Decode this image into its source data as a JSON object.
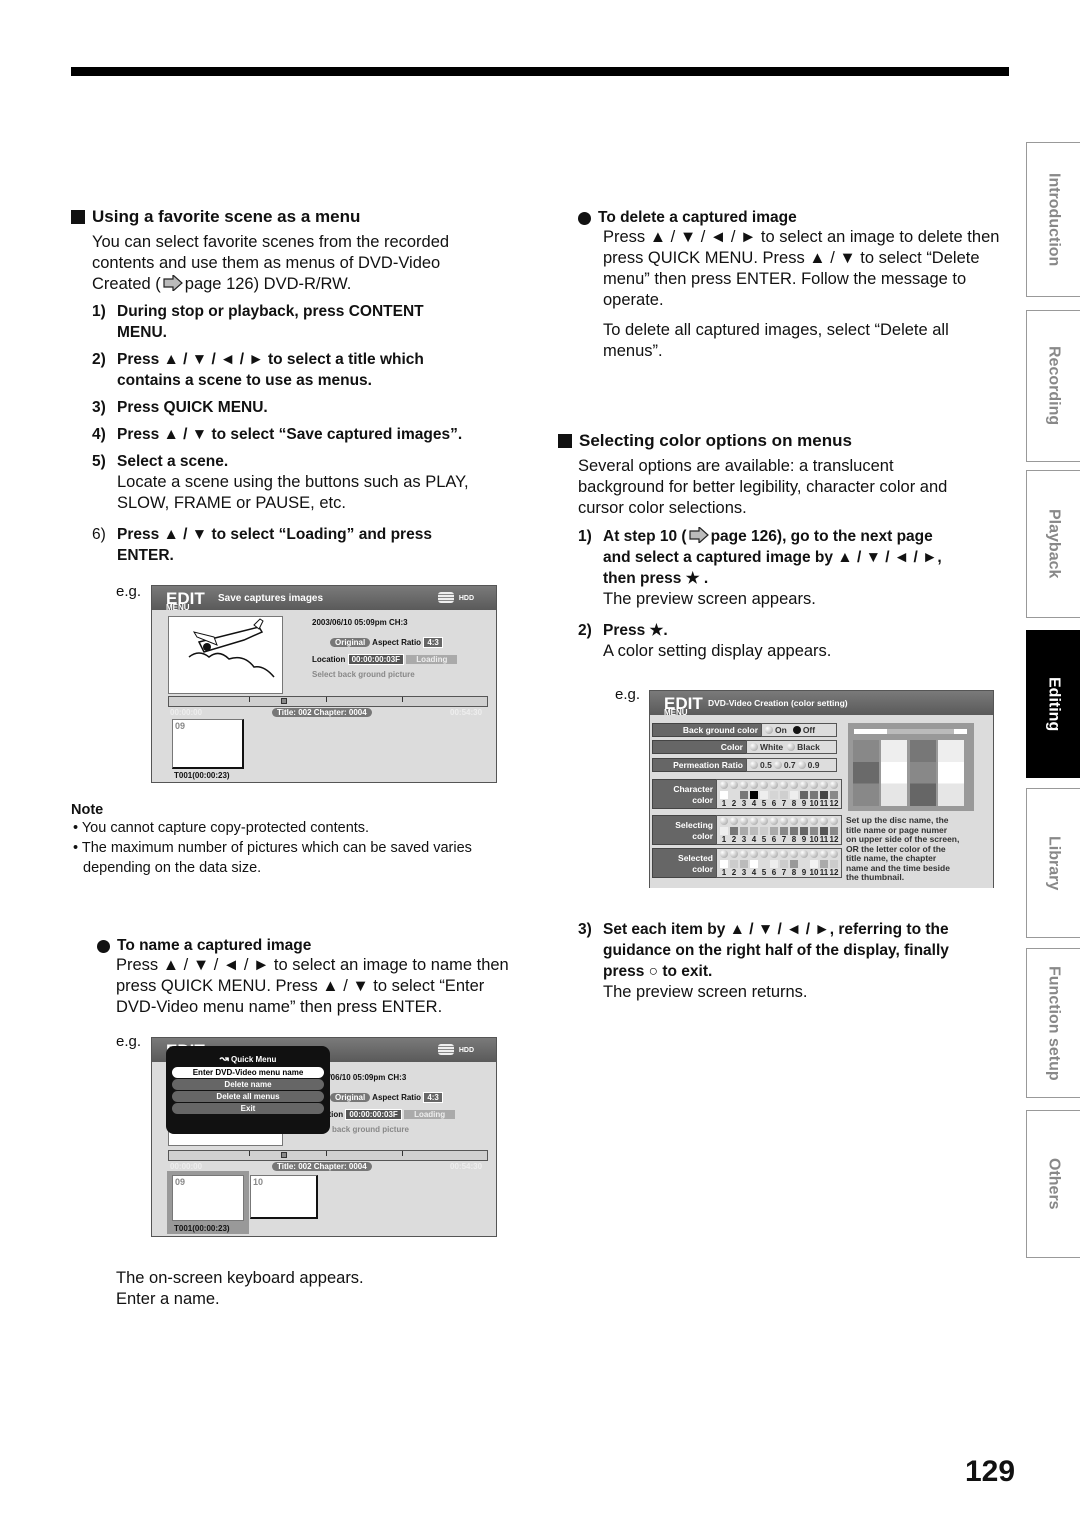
{
  "page_number": "129",
  "side_tabs": [
    {
      "label": "Introduction",
      "active": false
    },
    {
      "label": "Recording",
      "active": false
    },
    {
      "label": "Playback",
      "active": false
    },
    {
      "label": "Editing",
      "active": true
    },
    {
      "label": "Library",
      "active": false
    },
    {
      "label": "Function setup",
      "active": false
    },
    {
      "label": "Others",
      "active": false
    }
  ],
  "left": {
    "section_title": "Using a favorite scene as a menu",
    "intro_1": "You can select favorite scenes from the recorded",
    "intro_2": "contents and use them as menus of DVD-Video",
    "intro_3a": "Created (",
    "intro_3b": "page 126) DVD-R/RW.",
    "steps": [
      {
        "num": "1)",
        "line1": "During stop or playback, press CONTENT",
        "line2": "MENU."
      },
      {
        "num": "2)",
        "line1": "Press ▲ / ▼ / ◄ / ► to select a title which",
        "line2": "contains a scene to use as menus."
      },
      {
        "num": "3)",
        "line1": "Press QUICK MENU.",
        "line2": ""
      },
      {
        "num": "4)",
        "line1": "Press ▲ / ▼ to select “Save captured images”.",
        "line2": ""
      },
      {
        "num": "5)",
        "line1": "Select a scene.",
        "line2": ""
      },
      {
        "num": "6)",
        "line1": "Press ▲ / ▼ to select “Loading” and press",
        "line2": "ENTER."
      }
    ],
    "step5_desc_1": "Locate a scene using the buttons such as PLAY,",
    "step5_desc_2": "SLOW, FRAME or PAUSE, etc.",
    "eg_label": "e.g.",
    "screen1": {
      "logo": "EDIT",
      "logo_sub": "MENU",
      "title": "Save captures images",
      "media": "HDD",
      "datetime": "2003/06/10  05:09pm  CH:3",
      "original": "Original",
      "aspect_label": "Aspect Ratio",
      "aspect_value": "4:3",
      "location_label": "Location",
      "location_value": "00:00:00:03F",
      "loading": "Loading",
      "select_bg": "Select back ground picture",
      "time_start": "00:00:00",
      "title_chapter": "Title: 002  Chapter: 0004",
      "time_end": "00:54:30",
      "thumb_index": "09",
      "thumb_caption": "T001(00:00:23)"
    },
    "note": {
      "heading": "Note",
      "items": [
        "You cannot capture copy-protected contents.",
        "The maximum number of pictures which can be saved varies depending on the data size."
      ]
    },
    "name_section": {
      "title": "To name a captured image",
      "line1": "Press ▲ / ▼ / ◄ / ► to select an image to name then",
      "line2": "press QUICK MENU. Press ▲ / ▼ to select “Enter",
      "line3": "DVD-Video menu name” then press ENTER."
    },
    "screen2": {
      "logo": "EDIT",
      "media": "HDD",
      "datetime": "3/06/10  05:09pm  CH:3",
      "original": "Original",
      "aspect_label": "Aspect Ratio",
      "aspect_value": "4:3",
      "location_label": "ation",
      "location_value": "00:00:00:03F",
      "loading": "Loading",
      "select_bg": "back ground picture",
      "time_start": "00:00:00",
      "title_chapter": "Title: 002  Chapter: 0004",
      "time_end": "00:54:30",
      "thumb1_index": "09",
      "thumb2_index": "10",
      "thumb_caption": "T001(00:00:23)",
      "quick_menu_title": "Quick Menu",
      "quick_menu_items": [
        "Enter DVD-Video menu name",
        "Delete name",
        "Delete all menus",
        "Exit"
      ]
    },
    "keyboard_1": "The on-screen keyboard appears.",
    "keyboard_2": "Enter a name."
  },
  "right": {
    "delete_section": {
      "title": "To delete a captured image",
      "line1": "Press ▲ / ▼ / ◄ / ► to select an image to delete then",
      "line2": "press QUICK MENU. Press ▲ / ▼ to select “Delete",
      "line3": "menu” then press ENTER. Follow the message to",
      "line4": "operate.",
      "all_1": "To delete all captured images, select “Delete all",
      "all_2": "menus”."
    },
    "color_section": {
      "title": "Selecting color options on menus",
      "intro_1": "Several options are available: a translucent",
      "intro_2": "background for better legibility, character color and",
      "intro_3": "cursor color selections.",
      "step1_num": "1)",
      "step1_a": "At step 10 (",
      "step1_b": "page 126), go to the next page",
      "step1_line2": "and select a captured image by ▲ / ▼ / ◄ / ►,",
      "step1_line3": "then press ★ .",
      "step1_desc": "The preview screen appears.",
      "step2_num": "2)",
      "step2": "Press ★.",
      "step2_desc": "A color setting display appears.",
      "step3_num": "3)",
      "step3_line1": "Set each item by ▲ / ▼ / ◄ / ►, referring to the",
      "step3_line2": "guidance on the right half of the display, finally",
      "step3_line3": "press ○ to exit.",
      "step3_desc": "The preview screen returns."
    },
    "screen3": {
      "logo": "EDIT",
      "logo_sub": "MENU",
      "title": "DVD-Video Creation (color setting)",
      "bg_color_label": "Back ground color",
      "bg_options": [
        "On",
        "Off"
      ],
      "bg_selected": "Off",
      "color_label": "Color",
      "color_options": [
        "White",
        "Black"
      ],
      "perm_label": "Permeation Ratio",
      "perm_options": [
        "0.5",
        "0.7",
        "0.9"
      ],
      "char_label_1": "Character",
      "char_label_2": "color",
      "sel_label_1": "Selecting",
      "sel_label_2": "color",
      "seld_label_1": "Selected",
      "seld_label_2": "color",
      "numbers": [
        "1",
        "2",
        "3",
        "4",
        "5",
        "6",
        "7",
        "8",
        "9",
        "10",
        "11",
        "12"
      ],
      "char_swatches": [
        "#ffffff",
        "#dddddd",
        "#777777",
        "#000000",
        "#eeeeee",
        "#d5d5d5",
        "#cfcfcf",
        "#eeeeee",
        "#666666",
        "#777777",
        "#444444",
        "#888888"
      ],
      "sel_swatches": [
        "#eeeeee",
        "#777777",
        "#aaaaaa",
        "#bbbbbb",
        "#cccccc",
        "#aaaaaa",
        "#888888",
        "#777777",
        "#666666",
        "#888888",
        "#555555",
        "#888888"
      ],
      "seld_swatches": [
        "#ffffff",
        "#cccccc",
        "#bbbbbb",
        "#ffffff",
        "#dddddd",
        "#eeeeee",
        "#cccccc",
        "#999999",
        "#dddddd",
        "#f3f3f3",
        "#aaaaaa",
        "#cccccc"
      ],
      "guidance": [
        "Set up the disc name, the",
        "title name or page numer",
        "on upper side of the screen,",
        "OR the letter color of the",
        "title name, the chapter",
        "name and the time beside",
        "the thumbnail."
      ]
    }
  }
}
